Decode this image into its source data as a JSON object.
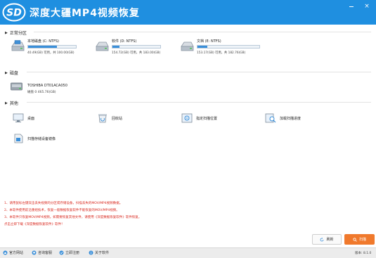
{
  "titlebar": {
    "title": "深度大疆MP4视频恢复",
    "logo_text": "SD",
    "close_glyph": "×"
  },
  "sections": {
    "partitions": "正常分区",
    "disks": "磁盘",
    "others": "其他"
  },
  "drives": [
    {
      "name": "本地磁盘 (C: NTFS)",
      "size": "40.49(GB) 可用，共 100.00(GB)",
      "used_fraction": 0.6
    },
    {
      "name": "软件 (D: NTFS)",
      "size": "154.72(GB) 可用，共 183.00(GB)",
      "used_fraction": 0.15
    },
    {
      "name": "文档 (E: NTFS)",
      "size": "153.17(GB) 可用，共 182.76(GB)",
      "used_fraction": 0.16
    }
  ],
  "disk": {
    "name": "TOSHIBA DT01ACA050",
    "info": "磁盘 0    465.76(GB)"
  },
  "others": [
    {
      "label": "桌面",
      "icon": "desktop-icon"
    },
    {
      "label": "回收站",
      "icon": "recycle-bin-icon"
    },
    {
      "label": "指定扫描位置",
      "icon": "scan-location-icon"
    },
    {
      "label": "加载扫描进度",
      "icon": "load-progress-icon"
    },
    {
      "label": "扫描存储设备镜像",
      "icon": "disk-image-icon"
    }
  ],
  "notes": [
    "1、请用鼠标左键双击丢失视频的分区或存储设备，扫描丢失的MOV/MP4视频数据。",
    "2、本软件使用前沿重组技术，恢复一般数据恢复软件不能恢复的MOV/MP4视频。",
    "3、本软件只恢复MOV/MP4视频。如需要恢复其他文件，请使用《深度数据恢复软件》软件恢复。",
    "    点击立即下载《深度数据恢复软件》软件！"
  ],
  "buttons": {
    "refresh": "刷新",
    "scan": "扫描"
  },
  "statusbar": {
    "links": [
      "官方网站",
      "咨询客服",
      "立即注册",
      "关于软件"
    ],
    "version": "版本: 8.1.0"
  },
  "colors": {
    "titlebar": "#1f8fe0",
    "scan_button": "#f0792c",
    "note_text": "#d9281e",
    "bar_fill": "#3a8fd9"
  }
}
